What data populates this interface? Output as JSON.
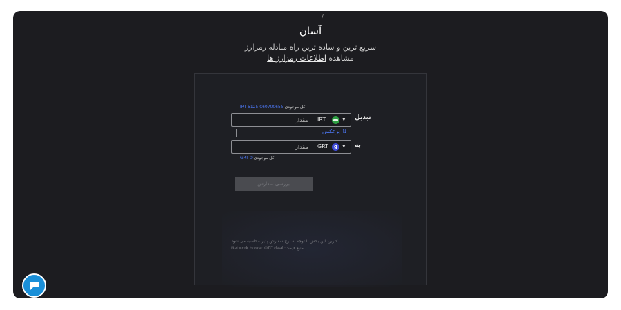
{
  "header": {
    "title": "آسان",
    "subtitle": "سریع ترین و ساده ترین راه مبادله رمزارز",
    "info_prefix": "مشاهده",
    "info_link": "اطلاعات رمزارز ها"
  },
  "form": {
    "from": {
      "label": "تبدیل",
      "balance_label": "کل موجودی:",
      "balance_value": "IRT 5125.060700655",
      "coin": "IRT",
      "coin_icon": "irt-coin-icon",
      "amount_placeholder": "مقدار"
    },
    "swap_label": "برعکس",
    "to": {
      "label": "به",
      "balance_label": "کل موجودی:",
      "balance_value": "GRT 0",
      "coin": "GRT",
      "coin_icon": "grt-coin-icon",
      "coin_glyph": "g",
      "amount_placeholder": "مقدار"
    },
    "submit_label": "بررسی سفارش",
    "footnote_1": "کاربرد این بخش با توجه به نرخ سفارش پذیر محاسبه می شود",
    "footnote_2": "Network broker OTC deal :منبع قیمت"
  },
  "colors": {
    "background": "#1c1c20",
    "accent": "#4f7cff",
    "chat": "#1a8fd8"
  }
}
